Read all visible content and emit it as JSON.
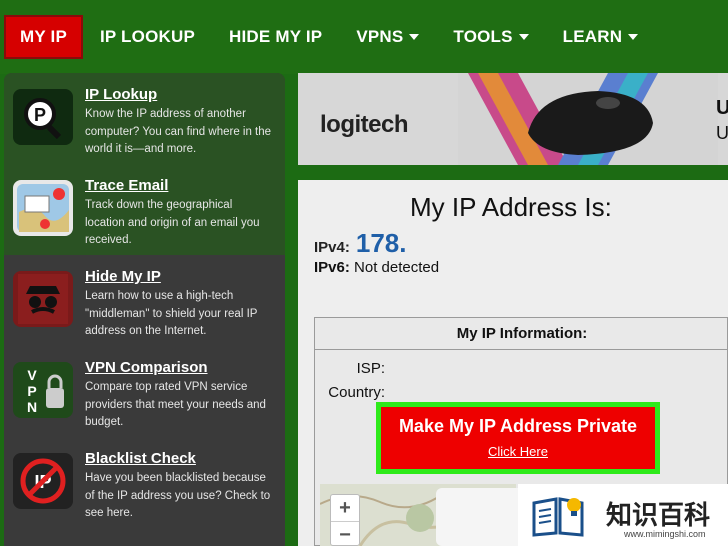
{
  "nav": {
    "items": [
      {
        "label": "MY IP",
        "active": true,
        "dropdown": false
      },
      {
        "label": "IP LOOKUP",
        "active": false,
        "dropdown": false
      },
      {
        "label": "HIDE MY IP",
        "active": false,
        "dropdown": false
      },
      {
        "label": "VPNS",
        "active": false,
        "dropdown": true
      },
      {
        "label": "TOOLS",
        "active": false,
        "dropdown": true
      },
      {
        "label": "LEARN",
        "active": false,
        "dropdown": true
      }
    ]
  },
  "sidebar": {
    "items": [
      {
        "title": "IP Lookup",
        "desc": "Know the IP address of another computer? You can find where in the world it is—and more.",
        "icon": "ip-lookup-icon"
      },
      {
        "title": "Trace Email",
        "desc": "Track down the geographical location and origin of an email you received.",
        "icon": "map-pin-icon"
      },
      {
        "title": "Hide My IP",
        "desc": "Learn how to use a high-tech \"middleman\" to shield your real IP address on the Internet.",
        "icon": "spy-icon"
      },
      {
        "title": "VPN Comparison",
        "desc": "Compare top rated VPN service providers that meet your needs and budget.",
        "icon": "vpn-lock-icon"
      },
      {
        "title": "Blacklist Check",
        "desc": "Have you been blacklisted because of the IP address you use? Check to see here.",
        "icon": "blacklist-icon"
      }
    ]
  },
  "ad": {
    "brand": "logitech",
    "line1": "U",
    "line2": "U"
  },
  "main": {
    "heading": "My IP Address Is:",
    "ipv4_label": "IPv4:",
    "ipv4_value": "178.",
    "ipv6_label": "IPv6:",
    "ipv6_value": "Not detected"
  },
  "info": {
    "heading": "My IP Information:",
    "isp_label": "ISP:",
    "country_label": "Country:"
  },
  "cta": {
    "main": "Make My IP Address Private",
    "sub": "Click Here"
  },
  "map": {
    "zoom_in": "+",
    "zoom_out": "−"
  },
  "watermark": {
    "cn": "知识百科",
    "url": "www.mimingshi.com"
  },
  "colors": {
    "nav_green": "#1f6e13",
    "active_red": "#d60000",
    "ip_blue": "#1f5fa8",
    "cta_red": "#ee0000",
    "cta_border": "#2eea1a"
  }
}
